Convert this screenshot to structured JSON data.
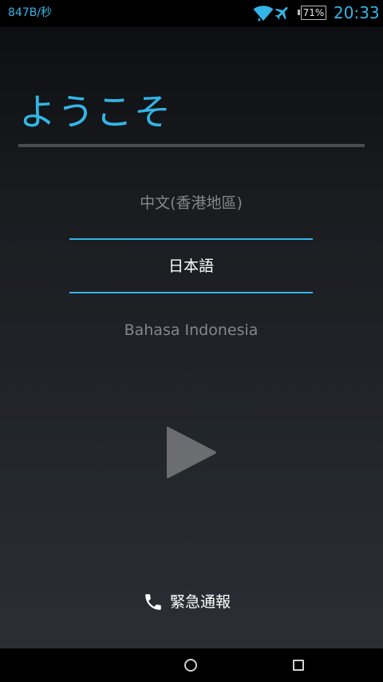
{
  "status_bar": {
    "net_speed": "847B/秒",
    "battery": "71%",
    "clock": "20:33",
    "icons": [
      "wifi-icon",
      "airplane-mode-icon",
      "battery-icon"
    ],
    "accent_color": "#33b5e5"
  },
  "header": {
    "title": "ようこそ"
  },
  "language_picker": {
    "above": "中文(香港地區)",
    "selected": "日本語",
    "below": "Bahasa Indonesia"
  },
  "start_button": {
    "icon": "play-icon"
  },
  "emergency": {
    "icon": "phone-icon",
    "label": "緊急通報"
  },
  "nav_bar": {
    "icons": [
      "home-icon",
      "recents-icon"
    ]
  }
}
